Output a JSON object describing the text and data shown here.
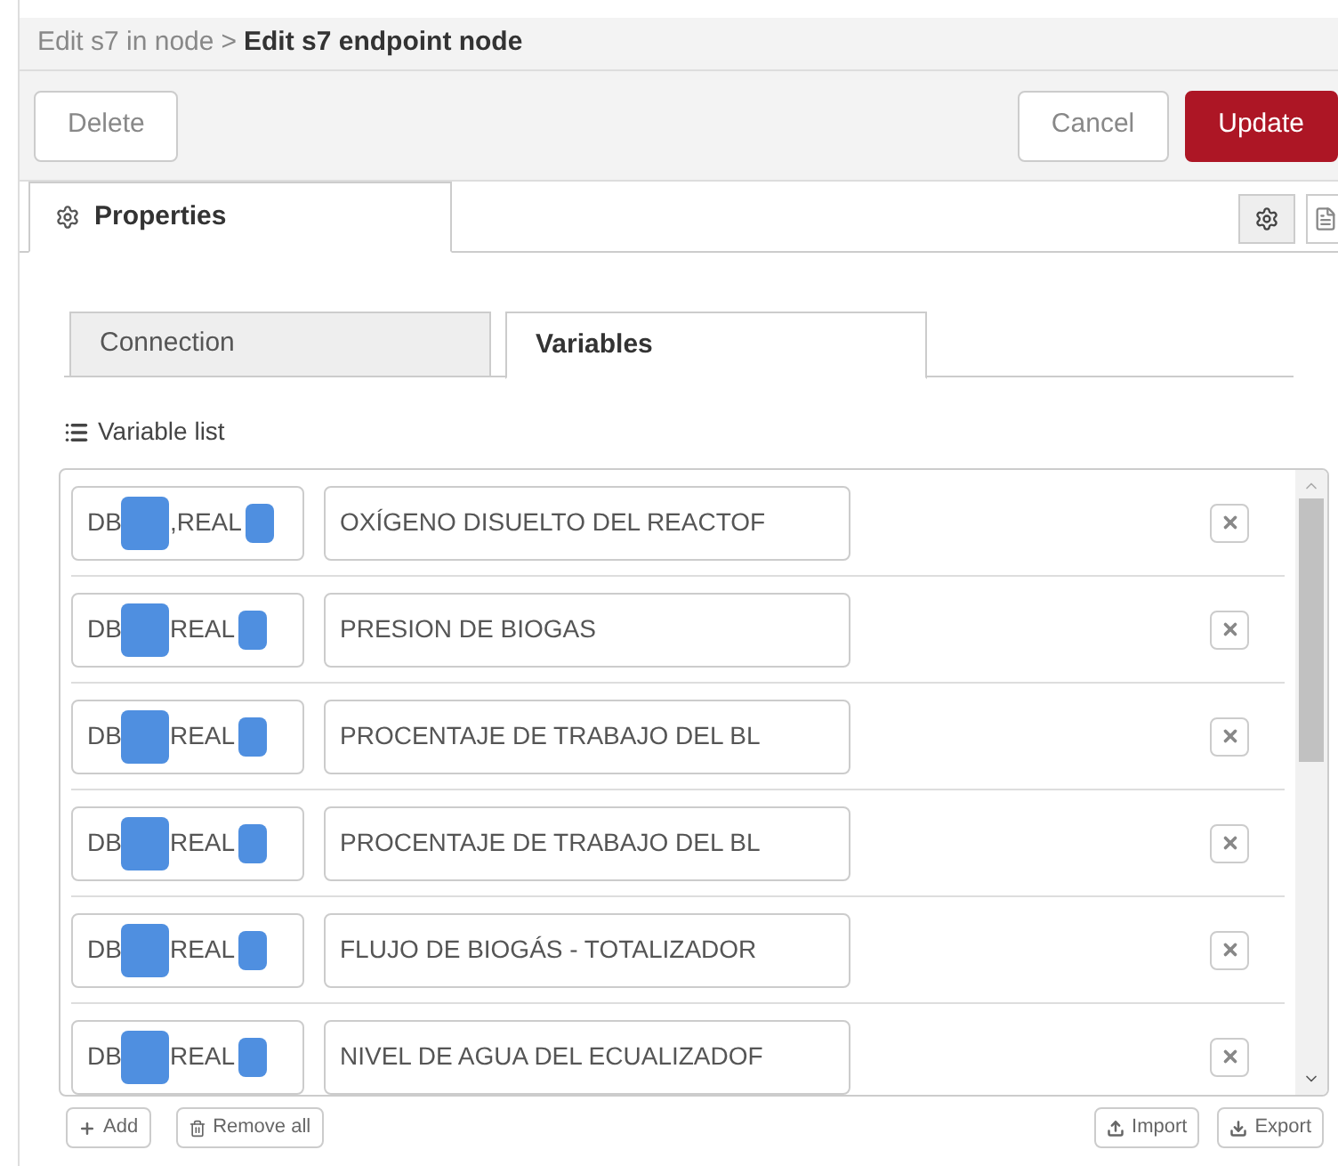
{
  "breadcrumb": {
    "parent": "Edit s7 in node",
    "separator": ">",
    "current": "Edit s7 endpoint node"
  },
  "toolbar": {
    "buttons": [
      {
        "label": "Delete",
        "kind": "plain"
      },
      {
        "label": "Cancel",
        "kind": "plain"
      },
      {
        "label": "Update",
        "kind": "primary"
      }
    ]
  },
  "panel_tabs": [
    {
      "label": "Properties",
      "selected": true
    }
  ],
  "sub_tabs": [
    {
      "label": "Connection",
      "selected": false
    },
    {
      "label": "Variables",
      "selected": true
    }
  ],
  "variable_list": {
    "title": "Variable list",
    "rows": [
      {
        "address_prefix": "DB",
        "address_type": ",REAL",
        "name": "OXÍGENO DISUELTO DEL REACTOF"
      },
      {
        "address_prefix": "DB",
        "address_type": "REAL",
        "name": "PRESION DE BIOGAS"
      },
      {
        "address_prefix": "DB",
        "address_type": "REAL",
        "name": "PROCENTAJE DE TRABAJO DEL BL"
      },
      {
        "address_prefix": "DB",
        "address_type": "REAL",
        "name": "PROCENTAJE DE TRABAJO DEL BL"
      },
      {
        "address_prefix": "DB",
        "address_type": "REAL",
        "name": "FLUJO DE BIOGÁS - TOTALIZADOR"
      },
      {
        "address_prefix": "DB",
        "address_type": "REAL",
        "name": "NIVEL DE AGUA DEL ECUALIZADOF"
      }
    ]
  },
  "footer": {
    "left": [
      {
        "label": "Add",
        "kind": "add"
      },
      {
        "label": "Remove all",
        "kind": "remove"
      }
    ],
    "right": [
      {
        "label": "Import",
        "kind": "import"
      },
      {
        "label": "Export",
        "kind": "export"
      }
    ]
  }
}
